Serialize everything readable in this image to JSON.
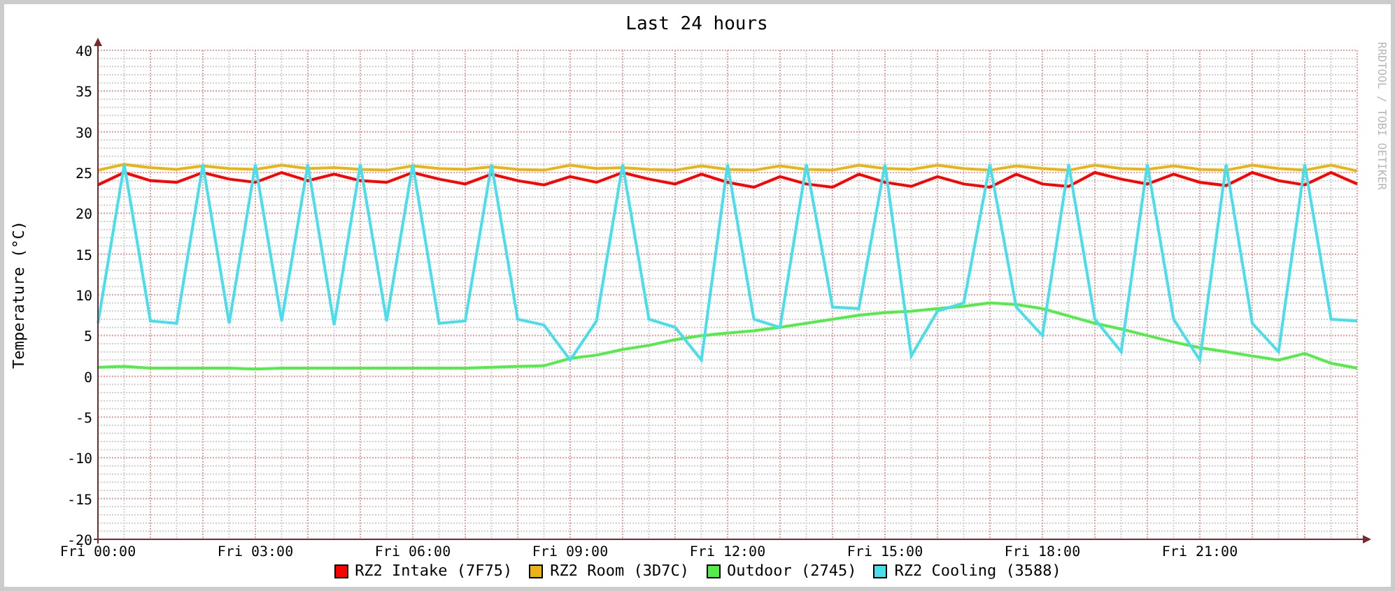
{
  "chart": {
    "credit": "RRDTOOL / TOBI OETIKER",
    "chart_data": {
      "type": "line",
      "title": "Last 24 hours",
      "ylabel": "Temperature (°C)",
      "categories": [
        "Fri 00:00",
        null,
        null,
        null,
        null,
        null,
        "Fri 03:00",
        null,
        null,
        null,
        null,
        null,
        "Fri 06:00",
        null,
        null,
        null,
        null,
        null,
        "Fri 09:00",
        null,
        null,
        null,
        null,
        null,
        "Fri 12:00",
        null,
        null,
        null,
        null,
        null,
        "Fri 15:00",
        null,
        null,
        null,
        null,
        null,
        "Fri 18:00",
        null,
        null,
        null,
        null,
        null,
        "Fri 21:00",
        null,
        null,
        null,
        null,
        null,
        null
      ],
      "ylim": [
        -20,
        40
      ],
      "grid": true,
      "yticks": [
        -20,
        -15,
        -10,
        -5,
        0,
        5,
        10,
        15,
        20,
        25,
        30,
        35,
        40
      ],
      "series": [
        {
          "name": "RZ2 Intake (7F75)",
          "color": "#ff0000",
          "values": [
            23.5,
            25,
            24,
            23.8,
            25,
            24.2,
            23.8,
            25,
            24,
            24.8,
            24,
            23.8,
            25,
            24.2,
            23.6,
            24.8,
            24,
            23.5,
            24.5,
            23.8,
            25,
            24.2,
            23.6,
            24.8,
            23.8,
            23.2,
            24.5,
            23.6,
            23.2,
            24.8,
            23.8,
            23.3,
            24.5,
            23.6,
            23.2,
            24.8,
            23.6,
            23.3,
            25,
            24.2,
            23.6,
            24.8,
            23.8,
            23.4,
            25,
            24,
            23.5,
            25,
            23.6
          ]
        },
        {
          "name": "RZ2 Room (3D7C)",
          "color": "#eab513",
          "values": [
            25.3,
            26,
            25.6,
            25.4,
            25.8,
            25.5,
            25.4,
            25.9,
            25.5,
            25.6,
            25.4,
            25.3,
            25.8,
            25.5,
            25.4,
            25.7,
            25.4,
            25.3,
            25.9,
            25.5,
            25.6,
            25.4,
            25.3,
            25.8,
            25.4,
            25.3,
            25.8,
            25.4,
            25.3,
            25.9,
            25.5,
            25.4,
            25.9,
            25.5,
            25.3,
            25.8,
            25.5,
            25.3,
            25.9,
            25.5,
            25.4,
            25.8,
            25.4,
            25.3,
            25.9,
            25.5,
            25.3,
            25.9,
            25.2
          ]
        },
        {
          "name": "Outdoor (2745)",
          "color": "#54ec48",
          "values": [
            1.1,
            1.2,
            1,
            1,
            1,
            1,
            0.9,
            1,
            1,
            1,
            1,
            1,
            1,
            1,
            1,
            1.1,
            1.2,
            1.3,
            2.2,
            2.6,
            3.3,
            3.8,
            4.5,
            5,
            5.3,
            5.6,
            6,
            6.5,
            7,
            7.5,
            7.8,
            8,
            8.3,
            8.6,
            9,
            8.8,
            8.3,
            7.4,
            6.5,
            5.8,
            5,
            4.2,
            3.5,
            3,
            2.5,
            2,
            2.8,
            1.6,
            1
          ]
        },
        {
          "name": "RZ2 Cooling (3588)",
          "color": "#48deeb",
          "values": [
            6.5,
            26,
            6.8,
            6.5,
            26,
            6.5,
            26,
            6.8,
            26,
            6.3,
            26,
            6.8,
            26,
            6.5,
            6.8,
            26,
            7,
            6.3,
            2,
            6.8,
            26,
            7,
            6,
            2,
            26,
            7,
            6,
            26,
            8.5,
            8.3,
            26,
            2.5,
            8,
            9,
            26,
            8.5,
            5,
            26,
            7,
            3,
            26,
            7,
            2,
            26,
            6.5,
            3,
            26,
            7,
            6.8
          ]
        }
      ]
    }
  }
}
